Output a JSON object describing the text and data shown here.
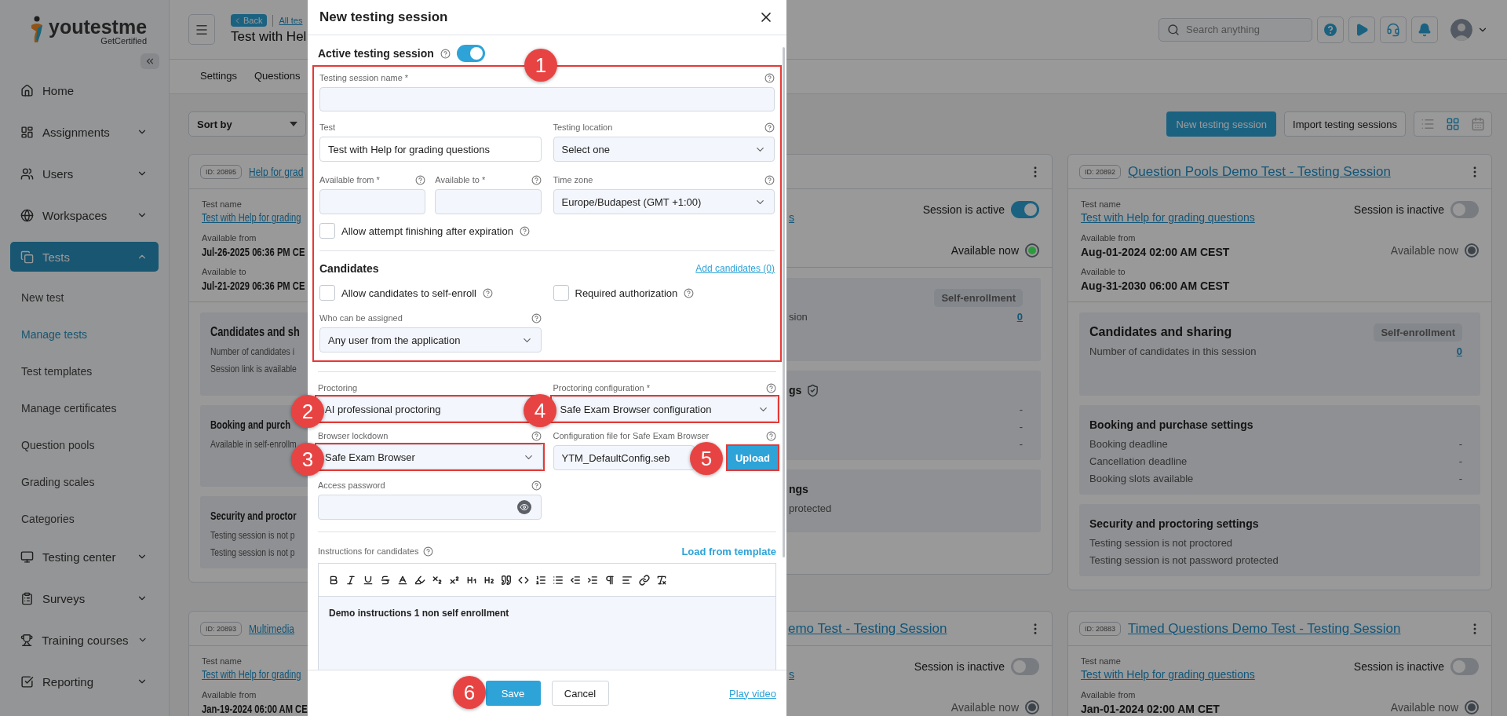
{
  "sidebar": {
    "logo": "youtestme",
    "tagline": "GetCertified",
    "items": [
      {
        "label": "Home",
        "kind": "link",
        "selected": false
      },
      {
        "label": "Assignments",
        "kind": "group",
        "selected": false,
        "expanded": false
      },
      {
        "label": "Users",
        "kind": "group",
        "selected": false,
        "expanded": false
      },
      {
        "label": "Workspaces",
        "kind": "group",
        "selected": false,
        "expanded": false
      },
      {
        "label": "Tests",
        "kind": "group",
        "selected": true,
        "expanded": true,
        "children": [
          {
            "label": "New test",
            "selected": false
          },
          {
            "label": "Manage tests",
            "selected": true
          },
          {
            "label": "Test templates",
            "selected": false
          },
          {
            "label": "Manage certificates",
            "selected": false
          },
          {
            "label": "Question pools",
            "selected": false
          },
          {
            "label": "Grading scales",
            "selected": false
          },
          {
            "label": "Categories",
            "selected": false
          }
        ]
      },
      {
        "label": "Testing center",
        "kind": "group",
        "selected": false,
        "expanded": false
      },
      {
        "label": "Surveys",
        "kind": "group",
        "selected": false,
        "expanded": false
      },
      {
        "label": "Training courses",
        "kind": "group",
        "selected": false,
        "expanded": false
      },
      {
        "label": "Reporting",
        "kind": "group",
        "selected": false,
        "expanded": false
      }
    ]
  },
  "header": {
    "back": "Back",
    "breadcrumb": "All tes",
    "title": "Test with Hel",
    "search_placeholder": "Search anything"
  },
  "tabs": [
    {
      "label": "Settings",
      "selected": false
    },
    {
      "label": "Questions",
      "selected": false
    }
  ],
  "toolbar": {
    "sort": "Sort by",
    "primary": "New testing session",
    "secondary": "Import testing sessions",
    "views": [
      {
        "selected": false
      },
      {
        "selected": true
      },
      {
        "selected": false
      }
    ]
  },
  "cards": [
    {
      "id": "ID: 20895",
      "title": "Help for grad",
      "test_label": "Test name",
      "test_link": "Test with Help for grading",
      "from_label": "Available from",
      "from": "Jul-26-2025 06:36 PM CE",
      "to_label": "Available to",
      "to": "Jul-21-2029 06:36 PM CE",
      "sections": [
        {
          "title": "Candidates and sh",
          "rows": [
            {
              "label": "Number of candidates i"
            },
            {
              "label": "Session link is available"
            }
          ]
        },
        {
          "title": "Booking and purch",
          "rows": [
            {
              "label": "Available in self-enrollm"
            }
          ]
        },
        {
          "title": "Security and proctor",
          "rows": [
            {
              "label": "Testing session is not p"
            },
            {
              "label": "Testing session is not p"
            }
          ]
        }
      ]
    },
    {
      "test_link": "s",
      "session": {
        "label": "Session is active",
        "on": true
      },
      "availability": {
        "label": "Available now",
        "color": "#2e9a3e"
      },
      "sections": [
        {
          "badge": "Self-enrollment",
          "rows": [
            {
              "label": "sion",
              "value": "0",
              "kind": "link"
            }
          ]
        },
        {
          "title": "gs",
          "shield": true,
          "rows": [
            {
              "value": "-",
              "kind": "text"
            },
            {
              "value": "-",
              "kind": "text"
            },
            {
              "value": "-",
              "kind": "text"
            }
          ]
        },
        {
          "title": "ngs",
          "rows": [
            {
              "label": "protected"
            }
          ]
        }
      ]
    },
    {
      "id": "ID: 20892",
      "title": "Question Pools Demo Test - Testing Session",
      "test_label": "Test name",
      "test_link": "Test with Help for grading questions",
      "from_label": "Available from",
      "from": "Aug-01-2024 02:00 AM CEST",
      "to_label": "Available to",
      "to": "Aug-31-2030 06:00 AM CEST",
      "session": {
        "label": "Session is inactive",
        "on": false
      },
      "availability": {
        "label": "Available now",
        "color": "#3d434a"
      },
      "sections": [
        {
          "title": "Candidates and sharing",
          "badge": "Self-enrollment",
          "rows": [
            {
              "label": "Number of candidates in this session",
              "value": "0",
              "kind": "link"
            }
          ]
        },
        {
          "title": "Booking and purchase settings",
          "rows": [
            {
              "label": "Booking deadline",
              "value": "-",
              "kind": "text"
            },
            {
              "label": "Cancellation deadline",
              "value": "-",
              "kind": "text"
            },
            {
              "label": "Booking slots available",
              "value": "-",
              "kind": "text"
            }
          ]
        },
        {
          "title": "Security and proctoring settings",
          "rows": [
            {
              "label": "Testing session is not proctored"
            },
            {
              "label": "Testing session is not password protected"
            }
          ]
        }
      ]
    },
    {
      "id": "ID: 20893",
      "title": "Multimedia",
      "test_label": "Test name",
      "test_link": "Test with Help for grading",
      "from_label": "Available from",
      "from": "Jan-19-2024 06:00 AM CE"
    },
    {
      "title": "emo Test - Testing Session",
      "test_link": "s",
      "session": {
        "label": "Session is inactive",
        "on": false
      },
      "availability": {
        "label": "Available now",
        "color": "#3d434a"
      }
    },
    {
      "id": "ID: 20883",
      "title": "Timed Questions Demo Test - Testing Session",
      "test_label": "Test name",
      "test_link": "Test with Help for grading questions",
      "from_label": "Available from",
      "from": "Jan-01-2024 02:00 AM CET",
      "session": {
        "label": "Session is inactive",
        "on": false
      },
      "availability": {
        "label": "Available now",
        "color": "#3d434a"
      }
    }
  ],
  "modal": {
    "title": "New testing session",
    "active": {
      "label": "Active testing session",
      "on": true
    },
    "session_name": {
      "label": "Testing session name *"
    },
    "test": {
      "label": "Test",
      "value": "Test with Help for grading questions"
    },
    "location": {
      "label": "Testing location",
      "value": "Select one"
    },
    "available_from": {
      "label": "Available from *"
    },
    "available_to": {
      "label": "Available to *"
    },
    "time_zone": {
      "label": "Time zone",
      "value": "Europe/Budapest (GMT +1:00)"
    },
    "allow_finishing": {
      "label": "Allow attempt finishing after expiration",
      "checked": false
    },
    "candidates": {
      "title": "Candidates",
      "link": "Add candidates (0)",
      "self_enroll": {
        "label": "Allow candidates to self-enroll",
        "checked": false
      },
      "required_auth": {
        "label": "Required authorization",
        "checked": false
      },
      "assign": {
        "label": "Who can be assigned",
        "value": "Any user from the application"
      }
    },
    "proctoring": {
      "label": "Proctoring",
      "value": "AI professional proctoring"
    },
    "proctoring_config": {
      "label": "Proctoring configuration *",
      "value": "Safe Exam Browser configuration"
    },
    "lockdown": {
      "label": "Browser lockdown",
      "value": "Safe Exam Browser"
    },
    "config_file": {
      "label": "Configuration file for Safe Exam Browser",
      "value": "YTM_DefaultConfig.seb",
      "button": "Upload"
    },
    "password": {
      "label": "Access password"
    },
    "instructions": {
      "label": "Instructions for candidates",
      "link": "Load from template",
      "content": "Demo instructions 1 non self enrollment"
    },
    "footer": {
      "save": "Save",
      "cancel": "Cancel",
      "video": "Play video"
    }
  },
  "annotations": [
    {
      "number": "1"
    },
    {
      "number": "2"
    },
    {
      "number": "3"
    },
    {
      "number": "4"
    },
    {
      "number": "5"
    },
    {
      "number": "6"
    }
  ]
}
